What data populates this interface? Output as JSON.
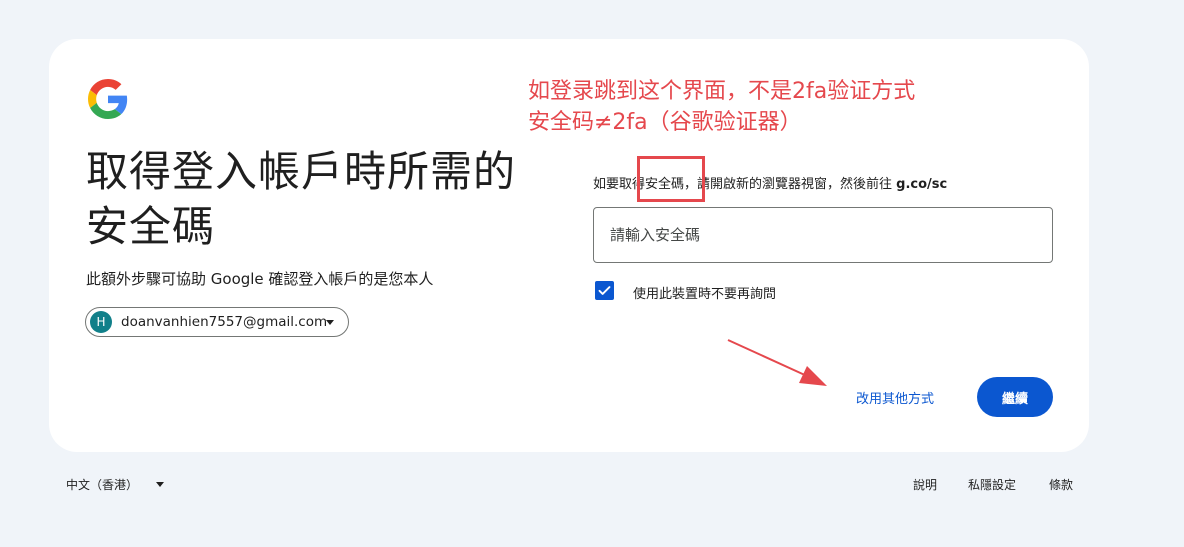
{
  "colors": {
    "page_background": "#f0f4f9",
    "card_background": "#ffffff",
    "primary_blue": "#0b57d0",
    "annotation_red": "#e5484d",
    "avatar_teal": "#11808a"
  },
  "brand": {
    "logo_icon": "google-g-logo-icon"
  },
  "heading": {
    "title": "取得登入帳戶時所需的安全碼",
    "subtitle": "此額外步驟可協助 Google 確認登入帳戶的是您本人"
  },
  "account": {
    "avatar_letter": "H",
    "email": "doanvanhien7557@gmail.com",
    "caret_icon": "caret-down-icon"
  },
  "annotation": {
    "line1": "如登录跳到这个界面，不是2fa验证方式",
    "line2": "安全码≠2fa（谷歌验证器）"
  },
  "form": {
    "instruction_prefix": "如要取得安全碼，請開啟新的瀏覽器視窗，然後前往 ",
    "instruction_url": "g.co/sc",
    "code_placeholder": "請輸入安全碼",
    "code_value": "",
    "remember_label": "使用此裝置時不要再詢問",
    "remember_checked": true
  },
  "actions": {
    "try_another_way": "改用其他方式",
    "next": "繼續"
  },
  "footer": {
    "language": "中文（香港）",
    "help": "說明",
    "privacy": "私隱設定",
    "terms": "條款"
  }
}
